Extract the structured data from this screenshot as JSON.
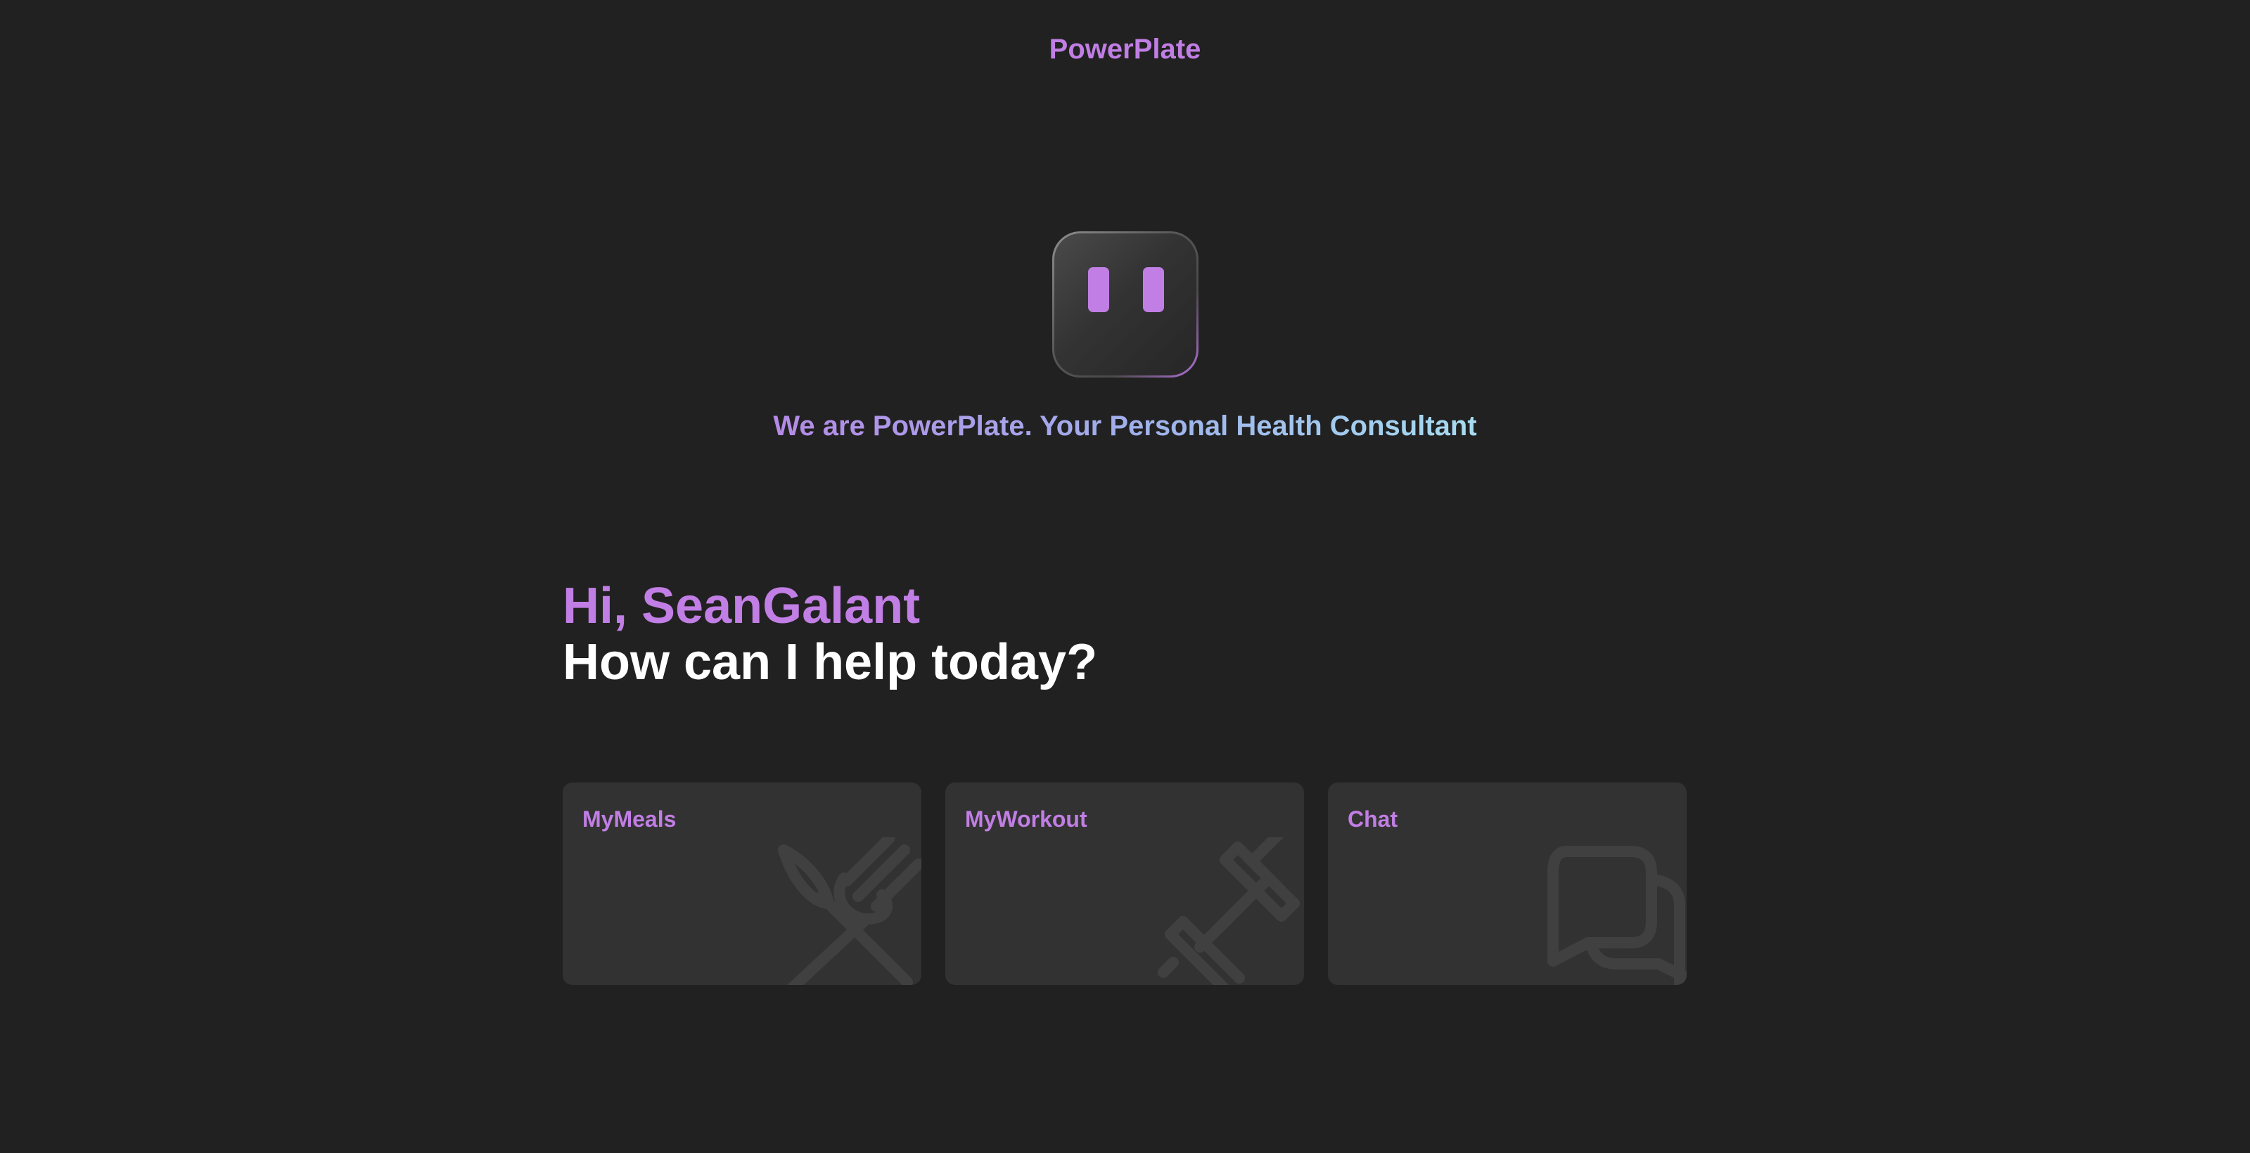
{
  "header": {
    "app_title": "PowerPlate"
  },
  "hero": {
    "tagline": "We are PowerPlate. Your Personal Health Consultant"
  },
  "greeting": {
    "hello": "Hi, SeanGalant",
    "prompt": "How can I help today?"
  },
  "cards": [
    {
      "label": "MyMeals",
      "icon": "fork-knife-icon"
    },
    {
      "label": "MyWorkout",
      "icon": "dumbbell-icon"
    },
    {
      "label": "Chat",
      "icon": "chat-bubbles-icon"
    }
  ],
  "colors": {
    "background": "#212121",
    "accent": "#c17ee4",
    "card": "#323232",
    "icon": "#404040",
    "tagline_start": "#b48ae6",
    "tagline_end": "#a6dcf0"
  }
}
